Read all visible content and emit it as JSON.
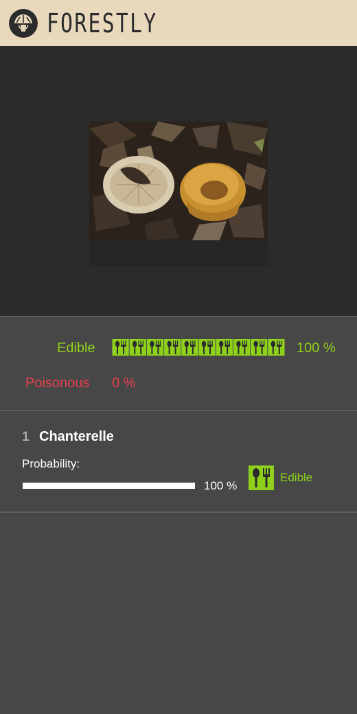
{
  "header": {
    "title": "FORESTLY",
    "logo_icon": "mushroom-logo-icon"
  },
  "photo": {
    "subject": "mushroom-photo"
  },
  "summary": {
    "edible_label": "Edible",
    "edible_percent": "100 %",
    "edible_level": 1.0,
    "edible_icon": "fork-spoon-icon",
    "poisonous_label": "Poisonous",
    "poisonous_percent": "0 %"
  },
  "results": [
    {
      "rank": "1",
      "name": "Chanterelle",
      "probability_label": "Probability:",
      "probability_percent": "100 %",
      "probability": 1.0,
      "edibility": "Edible",
      "edibility_icon": "fork-spoon-icon"
    }
  ],
  "colors": {
    "header_bg": "#e8d9bd",
    "edible": "#8fd11a",
    "poisonous": "#e8404a",
    "panel_bg": "#474747",
    "photo_bg": "#2b2b2b"
  }
}
